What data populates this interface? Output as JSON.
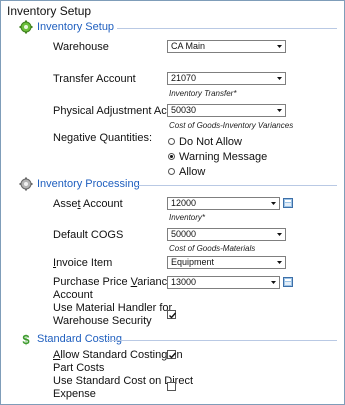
{
  "window": {
    "title": "Inventory Setup"
  },
  "sections": {
    "inventory_setup": {
      "title": "Inventory Setup",
      "icon": "gear-green-icon"
    },
    "inventory_processing": {
      "title": "Inventory Processing",
      "icon": "gear-gray-icon"
    },
    "standard_costing": {
      "title": "Standard Costing",
      "icon": "dollar-icon"
    }
  },
  "warehouse": {
    "label": "Warehouse",
    "value": "CA Main"
  },
  "transfer_account": {
    "label": "Transfer Account",
    "value": "21070",
    "hint": "Inventory Transfer*"
  },
  "physical_adjustment": {
    "label": "Physical Adjustment Account",
    "value": "50030",
    "hint": "Cost of Goods-Inventory Variances"
  },
  "negative_quantities": {
    "label": "Negative Quantities:",
    "options": [
      "Do Not Allow",
      "Warning Message",
      "Allow"
    ],
    "selected": "Warning Message"
  },
  "asset_account": {
    "label_pre": "Asse",
    "label_u": "t",
    "label_post": " Account",
    "value": "12000",
    "hint": "Inventory*"
  },
  "default_cogs": {
    "label": "Default COGS",
    "value": "50000",
    "hint": "Cost of Goods-Materials"
  },
  "invoice_item": {
    "label_u": "I",
    "label_post": "nvoice Item",
    "value": "Equipment"
  },
  "ppv_account": {
    "label_line1_pre": "Purchase Price ",
    "label_line1_u": "V",
    "label_line1_post": "ariance",
    "label_line2": "Account",
    "value": "13000"
  },
  "material_handler": {
    "label_line1": "Use Material Handler for",
    "label_line2": "Warehouse Security",
    "checked": true
  },
  "allow_standard_costing": {
    "label_line1_u": "A",
    "label_line1_post": "llow Standard Costing on",
    "label_line2": "Part Costs",
    "checked": true
  },
  "use_standard_cost": {
    "label_line1": "Use Standard Cost on Direct",
    "label_line2": "Expense",
    "checked": false
  }
}
